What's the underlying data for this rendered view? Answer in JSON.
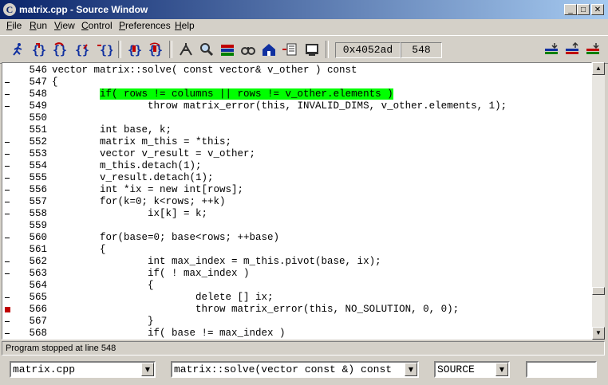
{
  "window": {
    "title": "matrix.cpp - Source Window",
    "app_icon": "C"
  },
  "menu": [
    {
      "label": "File",
      "u": "F",
      "rest": "ile"
    },
    {
      "label": "Run",
      "u": "R",
      "rest": "un"
    },
    {
      "label": "View",
      "u": "V",
      "rest": "iew"
    },
    {
      "label": "Control",
      "u": "C",
      "rest": "ontrol"
    },
    {
      "label": "Preferences",
      "u": "P",
      "rest": "references"
    },
    {
      "label": "Help",
      "u": "H",
      "rest": "elp"
    }
  ],
  "toolbar": {
    "address": "0x4052ad",
    "line": "548"
  },
  "highlight_color": "#00ff00",
  "breakpoint_color": "#c00000",
  "code_lines": [
    {
      "no": "546",
      "marker": "none",
      "text": "vector matrix::solve( const vector& v_other ) const"
    },
    {
      "no": "547",
      "marker": "dash",
      "text": "{"
    },
    {
      "no": "548",
      "marker": "dash",
      "text": "        if( rows != columns || rows != v_other.elements )",
      "highlight": true
    },
    {
      "no": "549",
      "marker": "dash",
      "text": "                throw matrix_error(this, INVALID_DIMS, v_other.elements, 1);"
    },
    {
      "no": "550",
      "marker": "none",
      "text": ""
    },
    {
      "no": "551",
      "marker": "none",
      "text": "        int base, k;"
    },
    {
      "no": "552",
      "marker": "dash",
      "text": "        matrix m_this = *this;"
    },
    {
      "no": "553",
      "marker": "dash",
      "text": "        vector v_result = v_other;"
    },
    {
      "no": "554",
      "marker": "dash",
      "text": "        m_this.detach(1);"
    },
    {
      "no": "555",
      "marker": "dash",
      "text": "        v_result.detach(1);"
    },
    {
      "no": "556",
      "marker": "dash",
      "text": "        int *ix = new int[rows];"
    },
    {
      "no": "557",
      "marker": "dash",
      "text": "        for(k=0; k<rows; ++k)"
    },
    {
      "no": "558",
      "marker": "dash",
      "text": "                ix[k] = k;"
    },
    {
      "no": "559",
      "marker": "none",
      "text": ""
    },
    {
      "no": "560",
      "marker": "dash",
      "text": "        for(base=0; base<rows; ++base)"
    },
    {
      "no": "561",
      "marker": "none",
      "text": "        {"
    },
    {
      "no": "562",
      "marker": "dash",
      "text": "                int max_index = m_this.pivot(base, ix);"
    },
    {
      "no": "563",
      "marker": "dash",
      "text": "                if( ! max_index )"
    },
    {
      "no": "564",
      "marker": "none",
      "text": "                {"
    },
    {
      "no": "565",
      "marker": "dash",
      "text": "                        delete [] ix;"
    },
    {
      "no": "566",
      "marker": "bp",
      "text": "                        throw matrix_error(this, NO_SOLUTION, 0, 0);"
    },
    {
      "no": "567",
      "marker": "dash",
      "text": "                }"
    },
    {
      "no": "568",
      "marker": "dash",
      "text": "                if( base != max_index )"
    }
  ],
  "status": "Program stopped at line 548",
  "file_combo": "matrix.cpp",
  "function_combo": "matrix::solve(vector const &) const",
  "mode_combo": "SOURCE",
  "search_input": ""
}
